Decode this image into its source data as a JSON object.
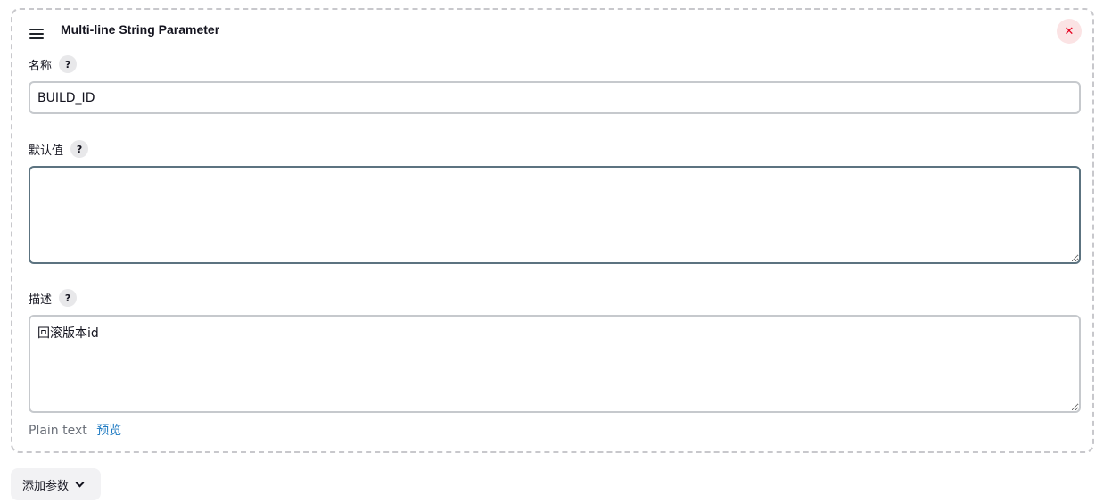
{
  "card": {
    "title": "Multi-line String Parameter",
    "close_symbol": "✕"
  },
  "fields": {
    "name": {
      "label": "名称",
      "help": "?",
      "value": "BUILD_ID"
    },
    "default_value": {
      "label": "默认值",
      "help": "?",
      "value": ""
    },
    "description": {
      "label": "描述",
      "help": "?",
      "value": "回滚版本id"
    }
  },
  "format": {
    "plain_text": "Plain text",
    "preview": "预览"
  },
  "add_parameter": {
    "label": "添加参数"
  },
  "colors": {
    "close_bg": "#fbe3e4",
    "close_fg": "#e6001f",
    "link": "#1e7ac2"
  }
}
